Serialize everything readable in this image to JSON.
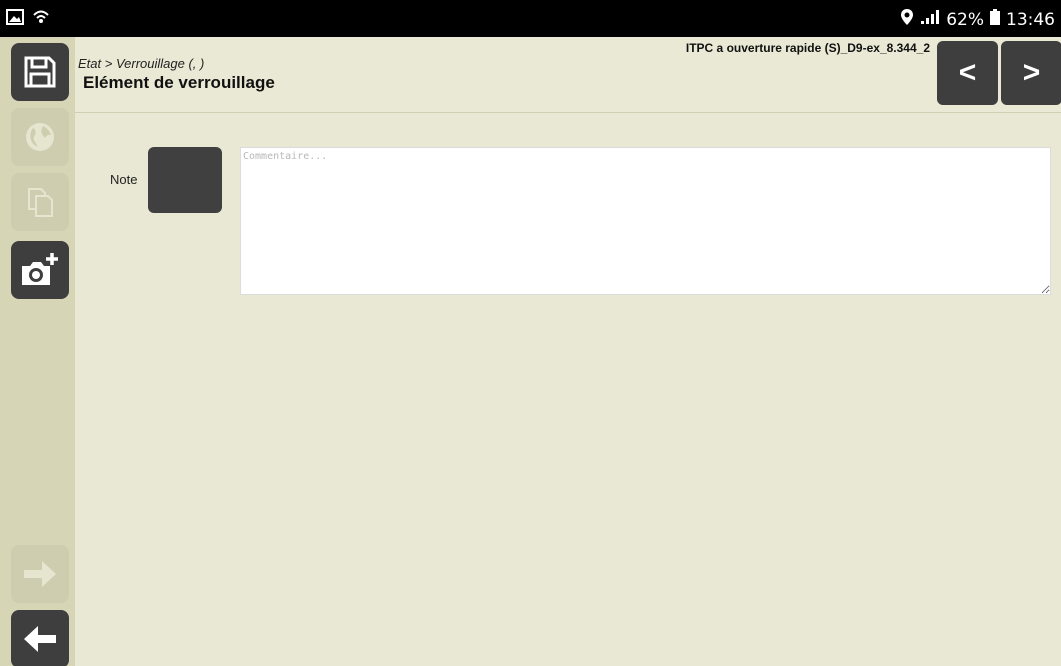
{
  "status_bar": {
    "icons": [
      "gallery-icon",
      "wifi-icon"
    ],
    "right_icons": [
      "location-pin-icon",
      "signal-icon",
      "battery-icon"
    ],
    "battery": "62%",
    "time": "13:46"
  },
  "sidebar": {
    "buttons": [
      {
        "name": "save-icon",
        "enabled": true
      },
      {
        "name": "globe-icon",
        "enabled": false
      },
      {
        "name": "copy-icon",
        "enabled": false
      },
      {
        "name": "camera-add-icon",
        "enabled": true
      },
      {
        "name": "arrow-right-icon",
        "enabled": false
      },
      {
        "name": "arrow-left-icon",
        "enabled": true
      }
    ]
  },
  "header": {
    "breadcrumb": "Etat > Verrouillage (, )",
    "title": "Elément de verrouillage",
    "document": "ITPC a ouverture rapide (S)_D9-ex_8.344_2",
    "prev_label": "<",
    "next_label": ">"
  },
  "form": {
    "note_label": "Note",
    "comment_placeholder": "Commentaire...",
    "comment_value": ""
  },
  "colors": {
    "background": "#e8e8d4",
    "sidebar": "#d6d5b6",
    "button": "#3e3e3e",
    "button_disabled": "#cfcdb0"
  }
}
